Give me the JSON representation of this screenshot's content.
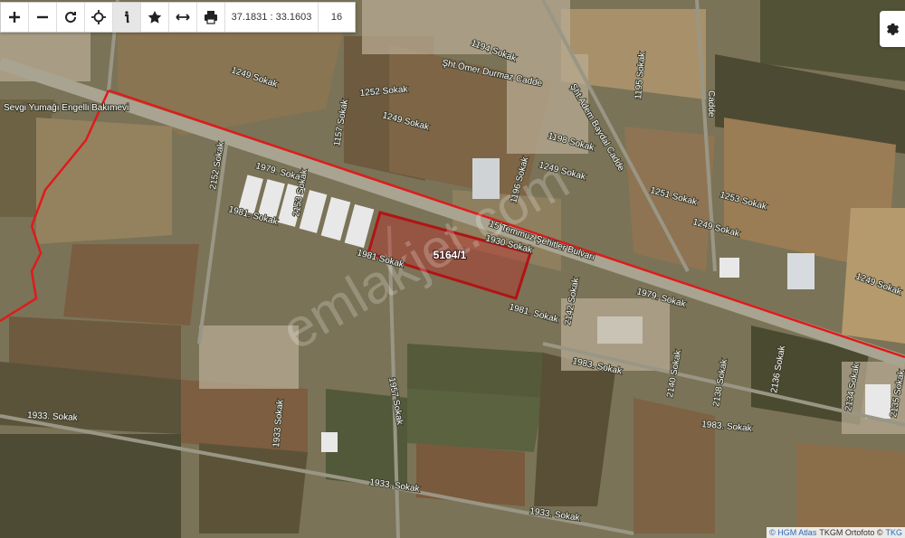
{
  "toolbar": {
    "buttons": [
      {
        "name": "zoom-in-icon",
        "label": "+"
      },
      {
        "name": "zoom-out-icon",
        "label": "−"
      },
      {
        "name": "refresh-icon",
        "label": ""
      },
      {
        "name": "locate-icon",
        "label": ""
      },
      {
        "name": "info-icon",
        "label": ""
      },
      {
        "name": "star-icon",
        "label": ""
      },
      {
        "name": "measure-icon",
        "label": ""
      },
      {
        "name": "print-icon",
        "label": ""
      }
    ],
    "coordinates": "37.1831 : 33.1603",
    "zoom_level": "16"
  },
  "parcel": {
    "label": "5164/1"
  },
  "watermark": "emlakjet.com",
  "streets": {
    "bakimevi": "Sevgi Yumağı Engelli Bakımevi",
    "boulevard": "15 Temmuz Şehitler Bulvarı",
    "omer": "Şht.Ömer Durmaz Cadde",
    "adem": "Şht.Adem Baydal Cadde",
    "cadde": "Cadde",
    "s1249a": "1249 Sokak",
    "s1252": "1252 Sokak",
    "s1249b": "1249 Sokak",
    "s1157": "1157 Sokak",
    "s1194": "1194 Sokak",
    "s1195": "1195 Sokak",
    "s1198": "1198 Sokak",
    "s1249c": "1249 Sokak",
    "s1251": "1251 Sokak",
    "s1253": "1253 Sokak",
    "s1249d": "1249 Sokak",
    "s1249e": "1249 Sokak",
    "s1979a": "1979. Sokak",
    "s2152": "2152 Sokak",
    "s2153": "2153 Sokak",
    "s1981a": "1981. Sokak",
    "s1981b": "1981 Sokak",
    "s1981c": "1981. Sokak",
    "s1030": "1930 Sokak",
    "s1196": "1196 Sokak",
    "s1979b": "1979. Sokak",
    "s2142": "2142 Sokak",
    "s1983a": "1983. Sokak",
    "s1983b": "1983. Sokak",
    "s2140": "2140 Sokak",
    "s2138": "2138 Sokak",
    "s2136": "2136 Sokak",
    "s2134": "2134 Sokak",
    "s2135": "2135 Sokak",
    "s1957": "1957 Sokak",
    "s1933a": "1933. Sokak",
    "s1933b": "1933. Sokak",
    "s1933c": "1933. Sokak",
    "s1933d": "1933 Sokak"
  },
  "attribution": {
    "hgm": "© HGM Atlas",
    "tkgm": "TKGM Ortofoto ©",
    "tkg": "TKG"
  }
}
